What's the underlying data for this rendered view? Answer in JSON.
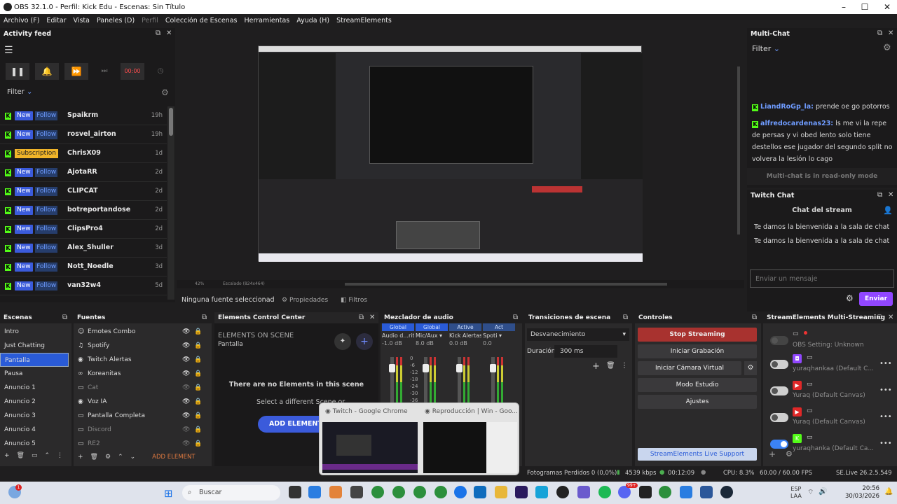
{
  "window": {
    "title": "OBS 32.1.0 - Perfil: Kick Edu - Escenas: Sin Título"
  },
  "menu": [
    "Archivo (F)",
    "Editar",
    "Vista",
    "Paneles (D)",
    "Perfil",
    "Colección de Escenas",
    "Herramientas",
    "Ayuda (H)",
    "StreamElements"
  ],
  "activity": {
    "title": "Activity feed",
    "timer": "00:00",
    "filter": "Filter",
    "rows": [
      {
        "b1": "New",
        "b2": "Follow",
        "name": "Spaikrm",
        "ago": "19h"
      },
      {
        "b1": "New",
        "b2": "Follow",
        "name": "rosvel_airton",
        "ago": "19h"
      },
      {
        "b1": "Subscription",
        "b2": "",
        "name": "ChrisX09",
        "ago": "1d"
      },
      {
        "b1": "New",
        "b2": "Follow",
        "name": "AjotaRR",
        "ago": "2d"
      },
      {
        "b1": "New",
        "b2": "Follow",
        "name": "CLIPCAT",
        "ago": "2d"
      },
      {
        "b1": "New",
        "b2": "Follow",
        "name": "botreportandose",
        "ago": "2d"
      },
      {
        "b1": "New",
        "b2": "Follow",
        "name": "ClipsPro4",
        "ago": "2d"
      },
      {
        "b1": "New",
        "b2": "Follow",
        "name": "Alex_Shuller",
        "ago": "3d"
      },
      {
        "b1": "New",
        "b2": "Follow",
        "name": "Nott_Noedle",
        "ago": "3d"
      },
      {
        "b1": "New",
        "b2": "Follow",
        "name": "van32w4",
        "ago": "5d"
      }
    ]
  },
  "preview": {
    "zoom": "42%",
    "scale": "Escalado (824x464)",
    "no_source": "Ninguna fuente seleccionad",
    "props": "Propiedades",
    "filters": "Filtros"
  },
  "multichat": {
    "title": "Multi-Chat",
    "filter": "Filter",
    "m1_user": "LiandRoGp_la:",
    "m1_text": " prende oe go potorros",
    "m2_user": "alfredocardenas23:",
    "m2_text": " ls me vi la repe de persas y vi obed lento solo tiene destellos ese jugador del segundo split no volvera la lesión lo cago",
    "readonly": "Multi-chat is in read-only mode"
  },
  "twitch": {
    "title": "Twitch Chat",
    "header": "Chat del stream",
    "welcome1": "Te damos la bienvenida a la sala de chat",
    "welcome2": "Te damos la bienvenida a la sala de chat",
    "placeholder": "Enviar un mensaje",
    "send": "Enviar"
  },
  "scenes": {
    "title": "Escenas",
    "items": [
      "Intro",
      "Just Chatting",
      "Pantalla",
      "Pausa",
      "Anuncio 1",
      "Anuncio 2",
      "Anuncio 3",
      "Anuncio 4",
      "Anuncio 5"
    ]
  },
  "sources": {
    "title": "Fuentes",
    "items": [
      "Emotes Combo",
      "Spotify",
      "Twitch Alertas",
      "Koreanitas",
      "Cat",
      "Voz IA",
      "Pantalla Completa",
      "Discord",
      "RE2"
    ]
  },
  "ecc": {
    "title": "Elements Control Center",
    "label": "ELEMENTS ON SCENE",
    "scene": "Pantalla",
    "empty": "There are no Elements in this scene",
    "hint": "Select a different Scene or",
    "add": "ADD ELEMENT",
    "add_source": "ADD ELEMENT"
  },
  "mixer": {
    "title": "Mezclador de audio",
    "cols": [
      {
        "tag": "Global",
        "name": "Audio d...ritorio",
        "db": "-1.0 dB"
      },
      {
        "tag": "Global",
        "name": "Mic/Aux",
        "db": "8.0 dB"
      },
      {
        "tag": "Active",
        "name": "Kick Alertas",
        "db": "0.0 dB"
      },
      {
        "tag": "Act",
        "name": "Spoti",
        "db": "0.0"
      }
    ],
    "ticks": [
      "0",
      "-6",
      "-12",
      "-18",
      "-24",
      "-30",
      "-36",
      "-42"
    ]
  },
  "transitions": {
    "title": "Transiciones de escena",
    "type": "Desvanecimiento",
    "dur_label": "Duración",
    "dur": "300 ms"
  },
  "controls": {
    "title": "Controles",
    "stop": "Stop Streaming",
    "rec": "Iniciar Grabación",
    "vcam": "Iniciar Cámara Virtual",
    "studio": "Modo Estudio",
    "settings": "Ajustes",
    "support": "StreamElements Live Support"
  },
  "multistream": {
    "title": "StreamElements Multi-Streaming",
    "rows": [
      "OBS Setting: Unknown",
      "yuraqhankaa (Default C...",
      "Yuraq (Default Canvas)",
      "Yuraq (Default Canvas)",
      "yuraqhanka (Default Ca..."
    ]
  },
  "thumbs": {
    "t1": "Twitch - Google Chrome",
    "t2": "Reproducción | Win - Goo..."
  },
  "status": {
    "dropped": "Fotogramas Perdidos 0 (0,0%)",
    "kbps": "4539 kbps",
    "time": "00:12:09",
    "cpu": "CPU: 8.3%",
    "fps": "60.00 / 60.00 FPS",
    "ver": "SE.Live 26.2.5.549"
  },
  "taskbar": {
    "search": "Buscar",
    "lang1": "ESP",
    "lang2": "LAA",
    "clock": "20:56",
    "date": "30/03/2026",
    "badge": "99+"
  }
}
